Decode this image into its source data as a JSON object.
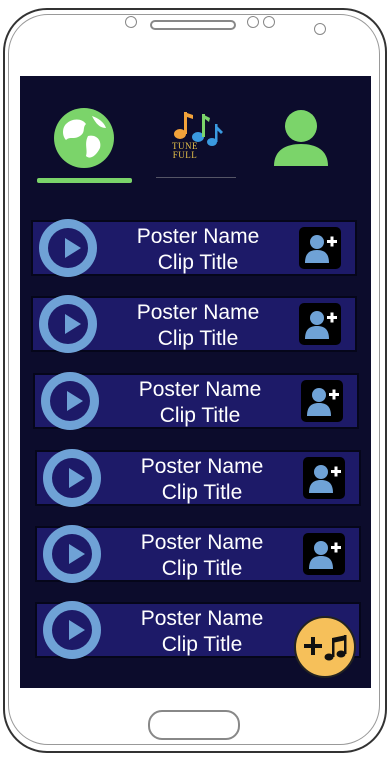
{
  "header": {
    "tabs": [
      {
        "name": "globe"
      },
      {
        "name": "home-logo",
        "logo_text_1": "TUNE",
        "logo_text_2": "FULL"
      },
      {
        "name": "profile"
      }
    ],
    "active_tab": "globe"
  },
  "clips": [
    {
      "poster": "Poster Name",
      "title": "Clip Title"
    },
    {
      "poster": "Poster Name",
      "title": "Clip Title"
    },
    {
      "poster": "Poster Name",
      "title": "Clip Title"
    },
    {
      "poster": "Poster Name",
      "title": "Clip Title"
    },
    {
      "poster": "Poster Name",
      "title": "Clip Title"
    },
    {
      "poster": "Poster Name",
      "title": "Clip Title"
    }
  ],
  "fab": {
    "icon": "add-music-icon",
    "label": "+♫"
  },
  "colors": {
    "screen_bg": "#0c0c2c",
    "row_bg": "#1d1a68",
    "accent_green": "#7bd46a",
    "play_blue": "#6fa2d6",
    "fab_yellow": "#f6c05a"
  }
}
